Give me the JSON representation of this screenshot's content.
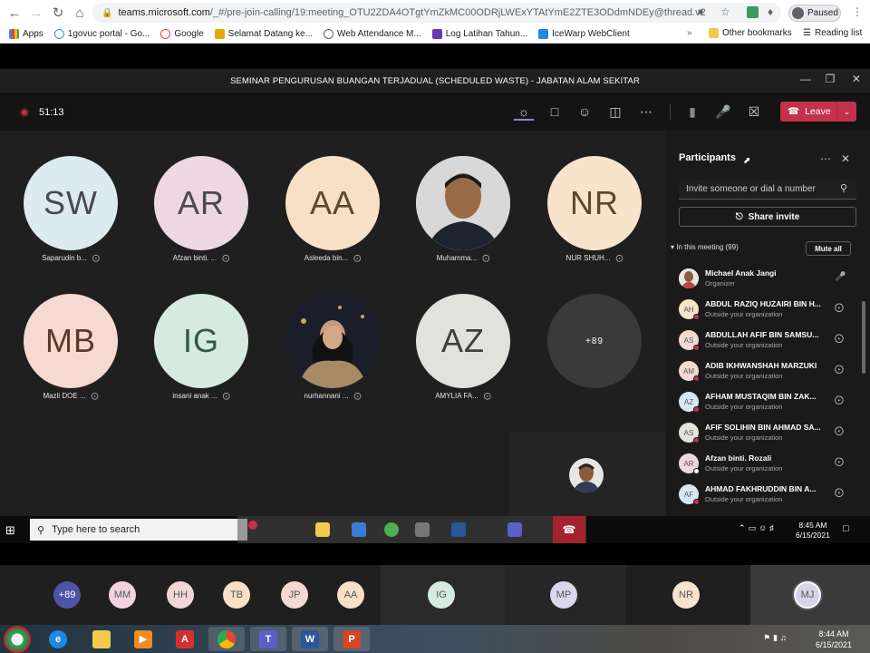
{
  "browser": {
    "url_domain": "teams.microsoft.com",
    "url_path": "/_#/pre-join-calling/19:meeting_OTU2ZDA4OTgtYmZkMC00ODRjLWExYTAtYmE2ZTE3ODdmNDEy@thread.v2",
    "profile_status": "Paused",
    "bookmarks": [
      "Apps",
      "1govuc portal - Go...",
      "Google",
      "Selamat Datang ke...",
      "Web Attendance M...",
      "Log Latihan Tahun...",
      "IceWarp WebClient"
    ],
    "other_bookmarks": "Other bookmarks",
    "reading_list": "Reading list"
  },
  "meeting": {
    "title": "SEMINAR PENGURUSAN BUANGAN TERJADUAL (SCHEDULED WASTE) - JABATAN ALAM SEKITAR",
    "timer": "51:13",
    "leave_label": "Leave"
  },
  "tiles": [
    {
      "initials": "SW",
      "name": "Saparudin b...",
      "color": "#dcebf0"
    },
    {
      "initials": "AR",
      "name": "Afzan binti. ...",
      "color": "#ecd7e3"
    },
    {
      "initials": "AA",
      "name": "Asleeda bin...",
      "color": "#f7e0c6"
    },
    {
      "initials": "",
      "name": "Muhamma...",
      "color": "#d9d9d9"
    },
    {
      "initials": "NR",
      "name": "NUR SHUH...",
      "color": "#f8e3cd"
    },
    {
      "initials": "MB",
      "name": "Mazli DOE ...",
      "color": "#f6d9cf"
    },
    {
      "initials": "IG",
      "name": "insani anak ...",
      "color": "#d6ebe0"
    },
    {
      "initials": "",
      "name": "nurhannani ...",
      "color": "#333"
    },
    {
      "initials": "AZ",
      "name": "AMYLIA FA...",
      "color": "#e2e2dc"
    },
    {
      "initials": "+89",
      "name": "",
      "color": "#3a3a3a"
    }
  ],
  "participants_pane": {
    "title": "Participants",
    "search_placeholder": "Invite someone or dial a number",
    "share_invite": "Share invite",
    "section": "In this meeting (99)",
    "mute_all": "Mute all",
    "list": [
      {
        "initials": "",
        "name": "Michael Anak Jangi",
        "sub": "Organizer",
        "color": "#d9d9d9"
      },
      {
        "initials": "AH",
        "name": "ABDUL RAZIQ HUZAIRI BIN H...",
        "sub": "Outside your organization",
        "color": "#f7e3c8"
      },
      {
        "initials": "AS",
        "name": "ABDULLAH AFIF BIN SAMSU...",
        "sub": "Outside your organization",
        "color": "#f3d9d2"
      },
      {
        "initials": "AM",
        "name": "ADIB IKHWANSHAH MARZUKI",
        "sub": "Outside your organization",
        "color": "#f3d9d2"
      },
      {
        "initials": "AZ",
        "name": "AFHAM MUSTAQIM BIN ZAK...",
        "sub": "Outside your organization",
        "color": "#d8e6ef"
      },
      {
        "initials": "AS",
        "name": "AFIF SOLIHIN BIN AHMAD SA...",
        "sub": "Outside your organization",
        "color": "#e3e3dc"
      },
      {
        "initials": "AR",
        "name": "Afzan binti. Rozali",
        "sub": "Outside your organization",
        "color": "#ecd7e3"
      },
      {
        "initials": "AF",
        "name": "AHMAD FAKHRUDDIN BIN A...",
        "sub": "Outside your organization",
        "color": "#d8e6ef"
      }
    ]
  },
  "inner_taskbar": {
    "search_placeholder": "Type here to search",
    "time": "8:45 AM",
    "date": "6/15/2021"
  },
  "strip": {
    "avatars": [
      {
        "initials": "+89",
        "color": "#4b55a6"
      },
      {
        "initials": "MM",
        "color": "#f1d3e0"
      },
      {
        "initials": "HH",
        "color": "#f2d7d6"
      },
      {
        "initials": "TB",
        "color": "#f7e0c6"
      },
      {
        "initials": "JP",
        "color": "#f3d9d2"
      },
      {
        "initials": "AA",
        "color": "#f7e0c6"
      },
      {
        "initials": "IG",
        "color": "#d6ebe0"
      },
      {
        "initials": "MP",
        "color": "#d9d6ee"
      },
      {
        "initials": "NR",
        "color": "#f8e3cd"
      },
      {
        "initials": "MJ",
        "color": "#d5d4e8"
      }
    ]
  },
  "taskbar": {
    "time": "8:44 AM",
    "date": "6/15/2021"
  }
}
